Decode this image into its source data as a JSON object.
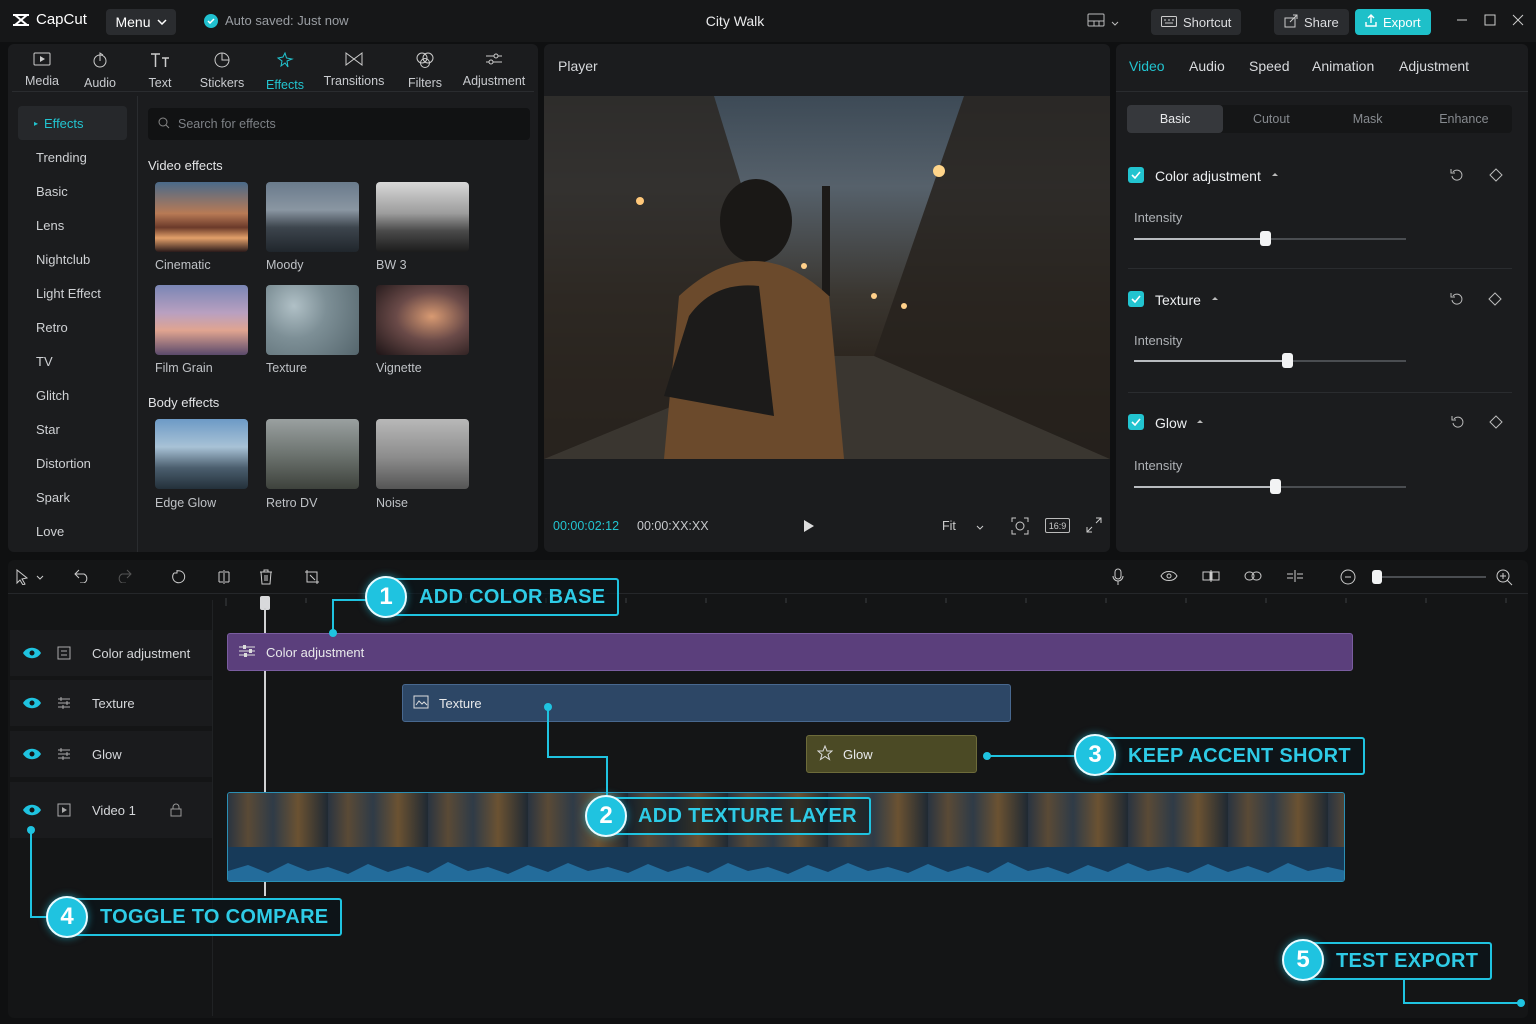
{
  "titlebar": {
    "app_name": "CapCut",
    "menu_label": "Menu",
    "autosave": "Auto saved: Just now",
    "project_title": "City Walk",
    "shortcut_label": "Shortcut",
    "share_label": "Share",
    "export_label": "Export"
  },
  "media_tabs": [
    {
      "label": "Media",
      "icon": "media-icon"
    },
    {
      "label": "Audio",
      "icon": "audio-icon"
    },
    {
      "label": "Text",
      "icon": "text-icon"
    },
    {
      "label": "Stickers",
      "icon": "stickers-icon"
    },
    {
      "label": "Effects",
      "icon": "effects-icon",
      "active": true
    },
    {
      "label": "Transitions",
      "icon": "transitions-icon"
    },
    {
      "label": "Filters",
      "icon": "filters-icon"
    },
    {
      "label": "Adjustment",
      "icon": "adjustment-icon"
    }
  ],
  "effects_sidebar": {
    "active": "Effects",
    "items": [
      "Trending",
      "Basic",
      "Lens",
      "Nightclub",
      "Light Effect",
      "Retro",
      "TV",
      "Glitch",
      "Star",
      "Distortion",
      "Spark",
      "Love"
    ]
  },
  "search": {
    "placeholder": "Search for effects"
  },
  "video_effects": {
    "title": "Video effects",
    "items": [
      "Cinematic",
      "Moody",
      "BW 3",
      "Film Grain",
      "Texture",
      "Vignette"
    ]
  },
  "body_effects": {
    "title": "Body effects",
    "items": [
      "Edge Glow",
      "Retro DV",
      "Noise"
    ]
  },
  "player": {
    "title": "Player",
    "current_time": "00:00:02:12",
    "total_time": "00:00:XX:XX",
    "fit_label": "Fit",
    "ratio_label": "16:9"
  },
  "inspector": {
    "tabs": [
      "Video",
      "Audio",
      "Speed",
      "Animation",
      "Adjustment"
    ],
    "active_tab": "Video",
    "subtabs": [
      "Basic",
      "Cutout",
      "Mask",
      "Enhance"
    ],
    "active_subtab": "Basic",
    "properties": [
      {
        "title": "Color adjustment",
        "label": "Intensity",
        "checked": true,
        "value": 0.48
      },
      {
        "title": "Texture",
        "label": "Intensity",
        "checked": true,
        "value": 0.56
      },
      {
        "title": "Glow",
        "label": "Intensity",
        "checked": true,
        "value": 0.52
      }
    ]
  },
  "timeline": {
    "tracks": [
      {
        "name": "Color adjustment",
        "clip_label": "Color adjustment",
        "color": "#5b3f7c"
      },
      {
        "name": "Texture",
        "clip_label": "Texture",
        "color": "#2d4766"
      },
      {
        "name": "Glow",
        "clip_label": "Glow",
        "color": "#4b4a25"
      },
      {
        "name": "Video 1",
        "clip_label": "",
        "color": "#1b3550"
      }
    ]
  },
  "callouts": [
    {
      "number": "1",
      "text": "ADD COLOR BASE"
    },
    {
      "number": "2",
      "text": "ADD TEXTURE LAYER"
    },
    {
      "number": "3",
      "text": "KEEP ACCENT SHORT"
    },
    {
      "number": "4",
      "text": "TOGGLE TO COMPARE"
    },
    {
      "number": "5",
      "text": "TEST EXPORT"
    }
  ],
  "colors": {
    "accent": "#22c4d0",
    "callout": "#1fc3e0"
  }
}
